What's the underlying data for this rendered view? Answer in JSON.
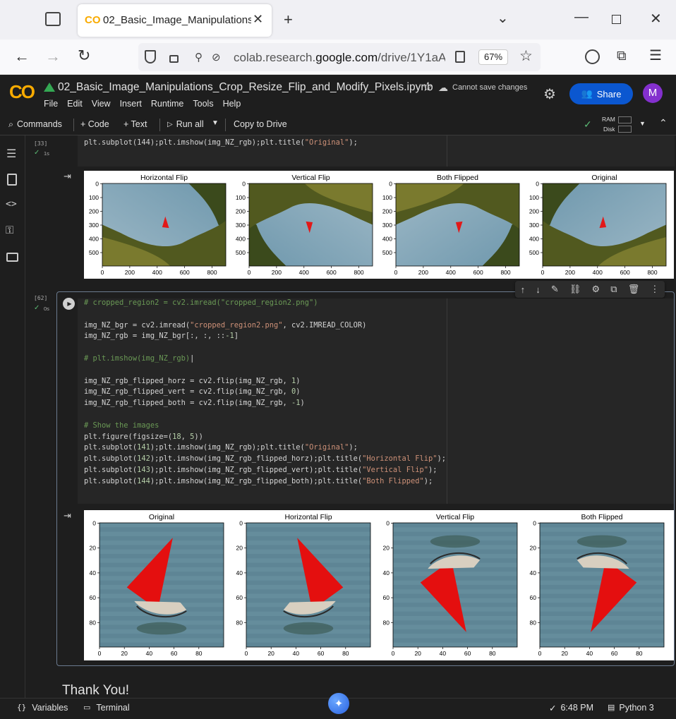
{
  "browser": {
    "tab_title": "02_Basic_Image_Manipulations_",
    "url_prefix": "colab.research.",
    "url_domain": "google.com",
    "url_suffix": "/drive/1Y1aA",
    "zoom": "67%",
    "profile_initial": "M"
  },
  "notebook": {
    "title": "02_Basic_Image_Manipulations_Crop_Resize_Flip_and_Modify_Pixels.ipynb",
    "save_status": "Cannot save changes",
    "share_label": "Share",
    "avatar_initial": "M",
    "menus": [
      "File",
      "Edit",
      "View",
      "Insert",
      "Runtime",
      "Tools",
      "Help"
    ]
  },
  "toolbar": {
    "commands": "Commands",
    "code": "+ Code",
    "text": "+ Text",
    "run_all": "Run all",
    "copy_to_drive": "Copy to Drive",
    "ram": "RAM",
    "disk": "Disk"
  },
  "cell1": {
    "exec_count": "[33]",
    "exec_time": "1s",
    "last_line": "plt.subplot(144);plt.imshow(img_NZ_rgb);plt.title(",
    "last_line_str": "\"Original\"",
    "last_line_end": ");",
    "plots": [
      {
        "title": "Horizontal Flip"
      },
      {
        "title": "Vertical Flip"
      },
      {
        "title": "Both Flipped"
      },
      {
        "title": "Original"
      }
    ],
    "yticks": [
      "0",
      "100",
      "200",
      "300",
      "400",
      "500"
    ],
    "xticks": [
      "0",
      "200",
      "400",
      "600",
      "800"
    ]
  },
  "cell2": {
    "exec_count": "[62]",
    "exec_time": "0s",
    "plots": [
      {
        "title": "Original"
      },
      {
        "title": "Horizontal Flip"
      },
      {
        "title": "Vertical Flip"
      },
      {
        "title": "Both Flipped"
      }
    ],
    "yticks": [
      "0",
      "20",
      "40",
      "60",
      "80"
    ],
    "xticks": [
      "0",
      "20",
      "40",
      "60",
      "80"
    ]
  },
  "text_cell": {
    "heading": "Thank You!"
  },
  "status": {
    "variables": "Variables",
    "terminal": "Terminal",
    "time": "6:48 PM",
    "runtime": "Python 3"
  },
  "colors": {
    "accent": "#f9ab00",
    "share_bg": "#0b57d0",
    "avatar_bg": "#8430ce",
    "check": "#5bb974"
  }
}
